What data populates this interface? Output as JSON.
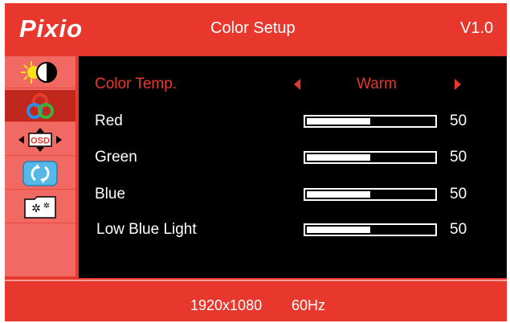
{
  "header": {
    "brand": "Pixio",
    "title": "Color Setup",
    "version": "V1.0"
  },
  "sidebar": {
    "items": [
      {
        "name": "brightness-contrast",
        "icon": "sun-contrast-icon"
      },
      {
        "name": "color-setup",
        "icon": "color-wheel-icon",
        "active": true
      },
      {
        "name": "osd",
        "icon": "osd-move-icon"
      },
      {
        "name": "reset",
        "icon": "refresh-icon"
      },
      {
        "name": "settings",
        "icon": "gears-icon"
      }
    ]
  },
  "menu": {
    "color_temp": {
      "label": "Color Temp.",
      "value": "Warm"
    },
    "red": {
      "label": "Red",
      "value": "50",
      "level": 0.5
    },
    "green": {
      "label": "Green",
      "value": "50",
      "level": 0.5
    },
    "blue": {
      "label": "Blue",
      "value": "50",
      "level": 0.5
    },
    "low_blue_light": {
      "label": "Low Blue Light",
      "value": "50",
      "level": 0.5
    }
  },
  "footer": {
    "resolution": "1920x1080",
    "refresh": "60Hz"
  },
  "colors": {
    "accent": "#e8372c",
    "background": "#000000",
    "sidebar": "#f06a63",
    "selected": "#c0271d"
  }
}
